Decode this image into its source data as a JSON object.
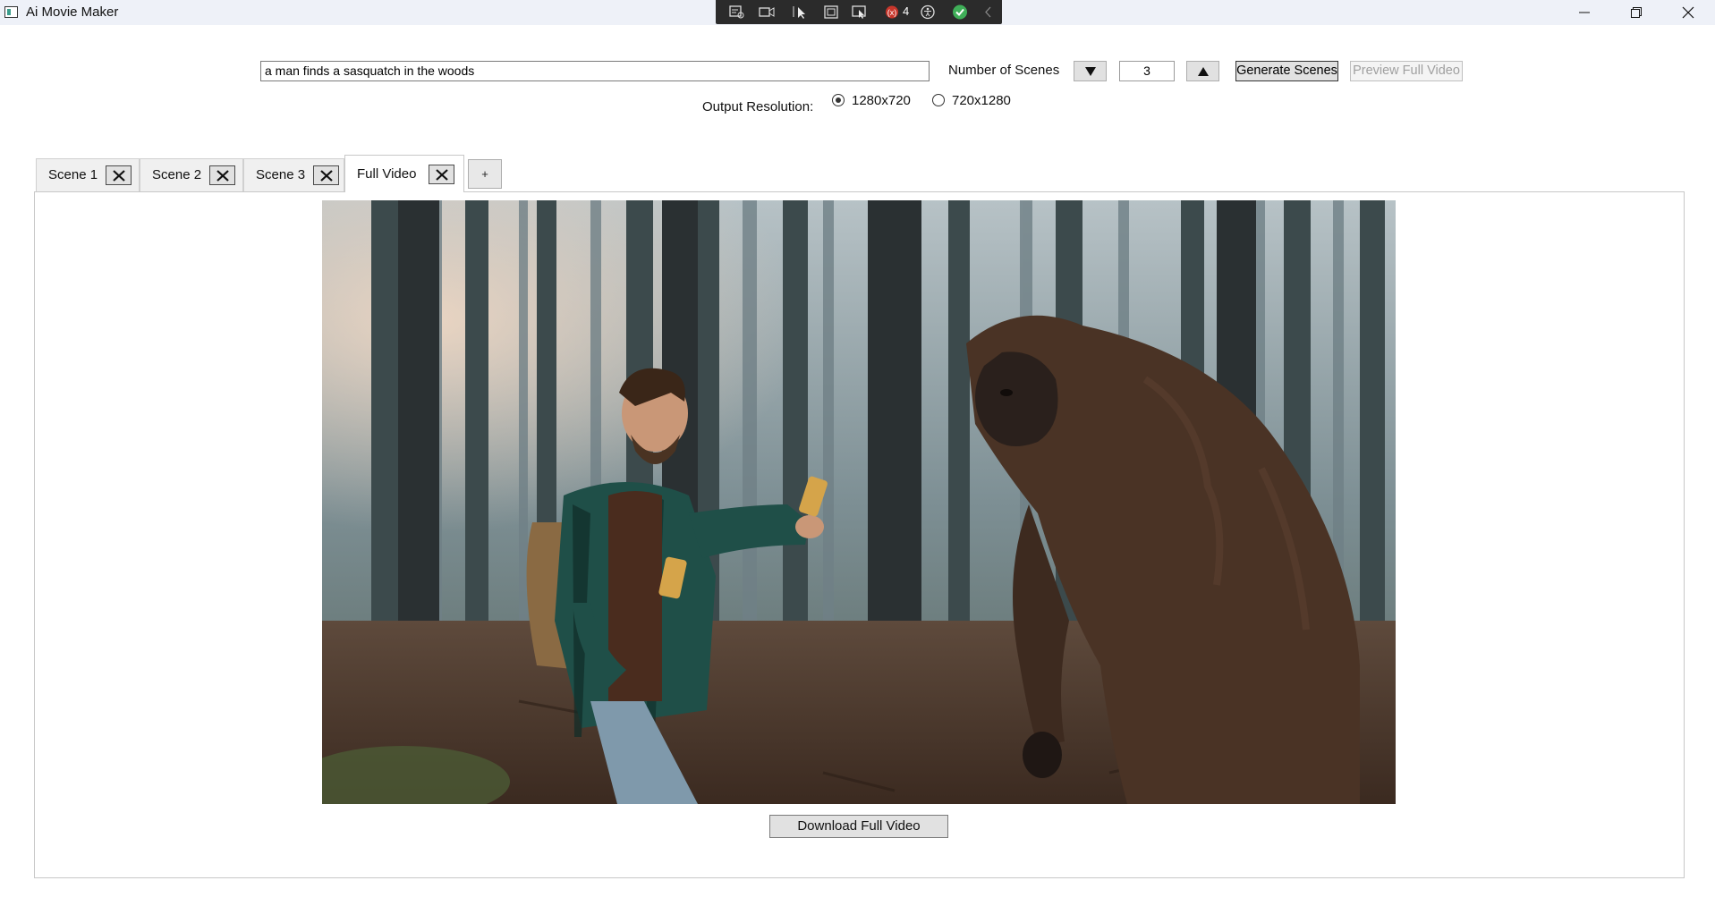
{
  "window": {
    "title": "Ai Movie Maker"
  },
  "debug_toolbar": {
    "counter": "4"
  },
  "form": {
    "prompt_value": "a man finds a sasquatch in the woods",
    "scenes_label": "Number of Scenes",
    "scenes_value": "3",
    "generate_label": "Generate Scenes",
    "preview_label": "Preview Full Video",
    "resolution_label": "Output Resolution:",
    "resolution_options": [
      {
        "label": "1280x720",
        "selected": true
      },
      {
        "label": "720x1280",
        "selected": false
      }
    ]
  },
  "tabs": [
    {
      "label": "Scene 1",
      "active": false
    },
    {
      "label": "Scene 2",
      "active": false
    },
    {
      "label": "Scene 3",
      "active": false
    },
    {
      "label": "Full Video",
      "active": true
    }
  ],
  "add_tab_label": "+",
  "download_label": "Download Full Video",
  "colors": {
    "accent_green": "#3fae58",
    "debug_bg": "#2b2b2b",
    "fur": "#4a3325"
  }
}
